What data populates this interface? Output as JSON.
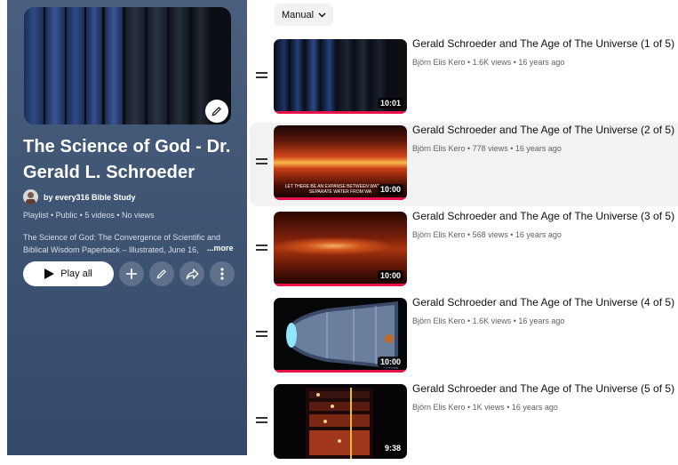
{
  "playlist": {
    "title": "The Science of God - Dr. Gerald L. Schroeder",
    "owner": "by every316 Bible Study",
    "meta": "Playlist • Public • 5 videos • No views",
    "description": "The Science of God: The Convergence of Scientific and Biblical Wisdom Paperback – Illustrated, June 16,",
    "more_label": "...more",
    "play_all_label": "Play all"
  },
  "sort": {
    "label": "Manual"
  },
  "icons": {
    "edit": "pencil-icon",
    "add": "plus-icon",
    "share": "share-icon",
    "more": "more-vert-icon",
    "drag": "drag-handle-icon",
    "sort": "chevron-down-icon"
  },
  "colors": {
    "progress": "#e8134a",
    "panel": "#3f5574"
  },
  "videos": [
    {
      "title": "Gerald Schroeder and The Age of The Universe (1 of 5)",
      "meta": "Björn Elis Kero • 1.6K views • 16 years ago",
      "duration": "10:01",
      "progress": 1.0
    },
    {
      "title": "Gerald Schroeder and The Age of The Universe (2 of 5)",
      "meta": "Björn Elis Kero • 778 views • 16 years ago",
      "duration": "10:00",
      "progress": 1.0,
      "caption": "LET THERE BE AN EXPANSE BETWEEN WATERS TO SEPARATE WATER FROM WA"
    },
    {
      "title": "Gerald Schroeder and The Age of The Universe (3 of 5)",
      "meta": "Björn Elis Kero • 568 views • 16 years ago",
      "duration": "10:00",
      "progress": 1.0
    },
    {
      "title": "Gerald Schroeder and The Age of The Universe (4 of 5)",
      "meta": "Björn Elis Kero • 1.6K views • 16 years ago",
      "duration": "10:00",
      "progress": 1.0
    },
    {
      "title": "Gerald Schroeder and The Age of The Universe (5 of 5)",
      "meta": "Björn Elis Kero • 1K views • 16 years ago",
      "duration": "9:38",
      "progress": 0.0
    }
  ]
}
